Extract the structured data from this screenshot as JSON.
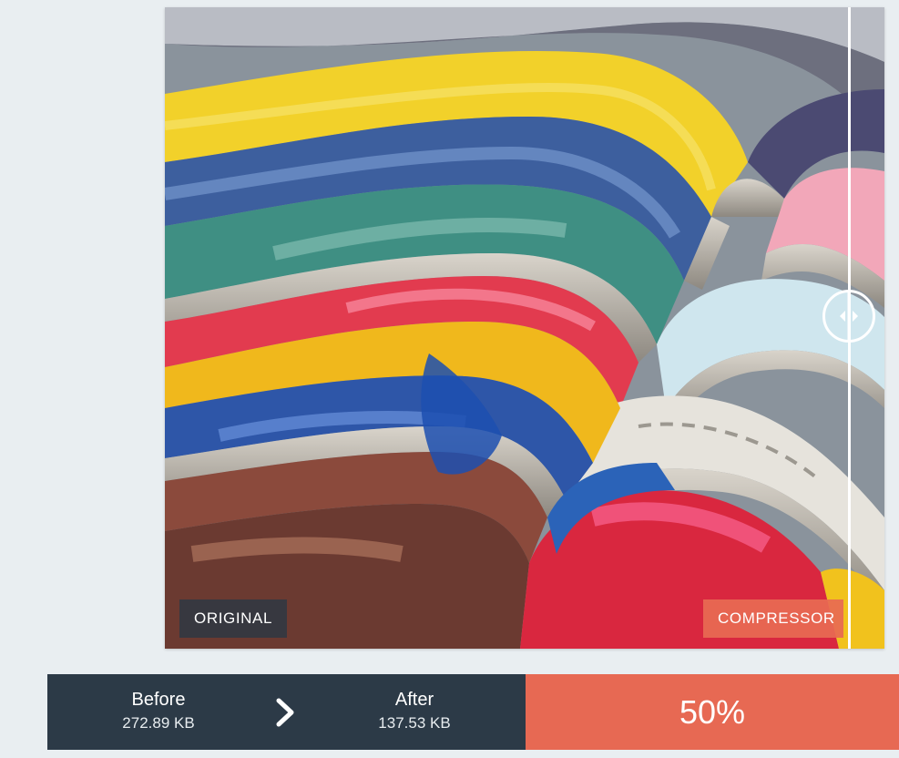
{
  "comparison": {
    "label_original": "ORIGINAL",
    "label_compressed": "COMPRESSOR",
    "handle_icon": "split-handle-arrows-icon",
    "divider_position_fraction": 0.95
  },
  "stats": {
    "before_label": "Before",
    "before_value": "272.89 KB",
    "after_label": "After",
    "after_value": "137.53 KB",
    "arrow_icon": "chevron-right-icon",
    "savings_percent": "50%"
  },
  "colors": {
    "page_background": "#e9eef1",
    "stats_dark": "#2c3a47",
    "accent": "#e76953",
    "tag_dark": "#2c3844"
  }
}
